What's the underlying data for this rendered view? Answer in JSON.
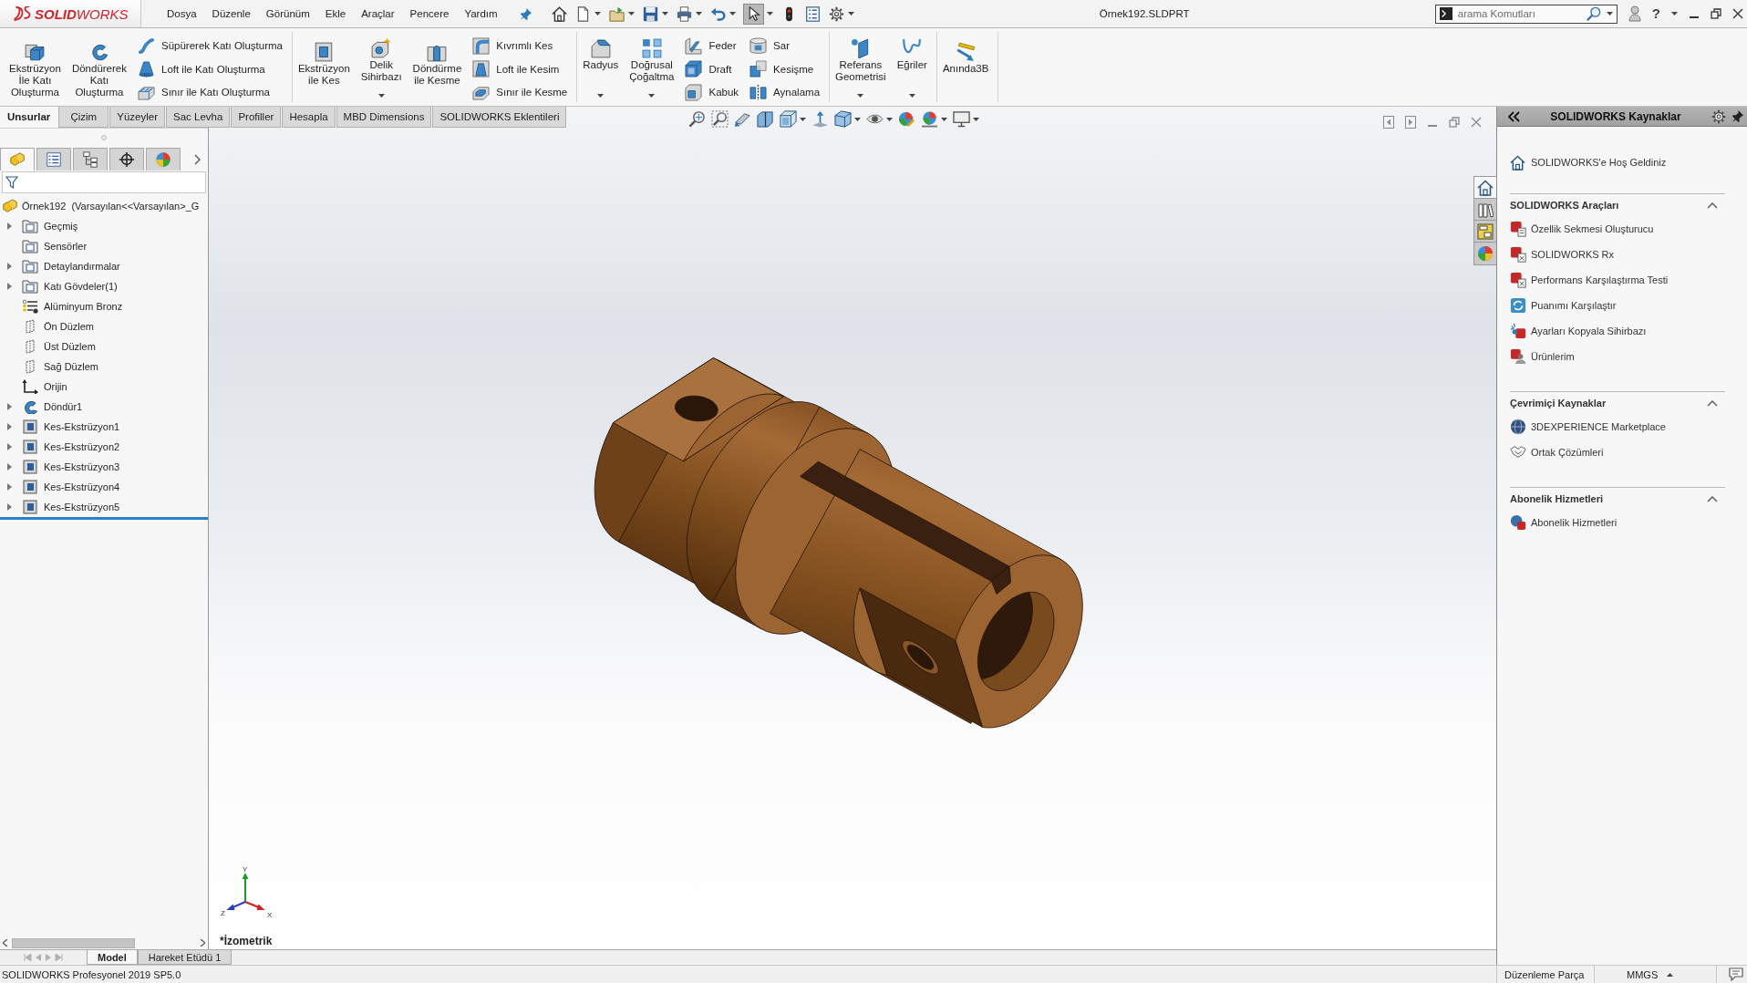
{
  "title_bar": {
    "logo": "**SOLID**WORKS",
    "menu": [
      "Dosya",
      "Düzenle",
      "Görünüm",
      "Ekle",
      "Araçlar",
      "Pencere",
      "Yardım"
    ],
    "quick_access": [
      {
        "dropdown": false,
        "selected": false
      },
      {
        "dropdown": true,
        "selected": false
      },
      {
        "dropdown": true,
        "selected": false
      },
      {
        "dropdown": true,
        "selected": false
      },
      {
        "dropdown": true,
        "selected": false
      },
      {
        "dropdown": true,
        "selected": false
      },
      {
        "dropdown": true,
        "selected": true
      },
      {
        "dropdown": false,
        "selected": false
      },
      {
        "dropdown": false,
        "selected": false
      },
      {
        "dropdown": true,
        "selected": false
      }
    ],
    "document": "Örnek192.SLDPRT",
    "search": {
      "placeholder": "arama Komutları"
    },
    "help": "?"
  },
  "ribbon": [
    {
      "columns": [
        {
          "kind": "large",
          "label": "Ekstrüzyon\nİle Katı\nOluşturma",
          "dropdown": false
        },
        {
          "kind": "large",
          "label": "Döndürerek\nKatı\nOluşturma",
          "dropdown": false
        },
        {
          "kind": "stack",
          "items": [
            "Süpürerek Katı Oluşturma",
            "Loft ile Katı Oluşturma",
            "Sınır ile Katı Oluşturma"
          ]
        }
      ]
    },
    {
      "columns": [
        {
          "kind": "large",
          "label": "Ekstrüzyon\nile Kes",
          "dropdown": false
        },
        {
          "kind": "large",
          "label": "Delik\nSihirbazı",
          "dropdown": true
        },
        {
          "kind": "large",
          "label": "Döndürme\nile Kesme",
          "dropdown": false
        },
        {
          "kind": "stack",
          "items": [
            "Kıvrımlı Kes",
            "Loft ile Kesim",
            "Sınır ile Kesme"
          ]
        }
      ]
    },
    {
      "columns": [
        {
          "kind": "large",
          "label": "Radyus",
          "dropdown": true
        },
        {
          "kind": "large",
          "label": "Doğrusal\nÇoğaltma",
          "dropdown": true
        },
        {
          "kind": "stack",
          "items": [
            "Feder",
            "Draft",
            "Kabuk"
          ]
        },
        {
          "kind": "stack",
          "items": [
            "Sar",
            "Kesişme",
            "Aynalama"
          ]
        }
      ]
    },
    {
      "columns": [
        {
          "kind": "large",
          "label": "Referans\nGeometrisi",
          "dropdown": true
        },
        {
          "kind": "large",
          "label": "Eğriler",
          "dropdown": true
        }
      ]
    },
    {
      "columns": [
        {
          "kind": "large",
          "label": "Anında3B",
          "dropdown": false
        }
      ]
    }
  ],
  "command_tabs": [
    {
      "label": "Unsurlar",
      "selected": true
    },
    {
      "label": "Çizim",
      "selected": false
    },
    {
      "label": "Yüzeyler",
      "selected": false
    },
    {
      "label": "Sac Levha",
      "selected": false
    },
    {
      "label": "Profiller",
      "selected": false
    },
    {
      "label": "Hesapla",
      "selected": false
    },
    {
      "label": "MBD Dimensions",
      "selected": false
    },
    {
      "label": "SOLIDWORKS Eklentileri",
      "selected": false
    }
  ],
  "feature_manager": {
    "panel_tabs": [
      {
        "selected": true
      },
      {
        "selected": false
      },
      {
        "selected": false
      },
      {
        "selected": false
      },
      {
        "selected": false
      }
    ],
    "tree": {
      "label": "Örnek192  (Varsayılan<<Varsayılan>_G",
      "children": [
        {
          "label": "Geçmiş",
          "kind": "folder",
          "expandable": true
        },
        {
          "label": "Sensörler",
          "kind": "folder",
          "expandable": false
        },
        {
          "label": "Detaylandırmalar",
          "kind": "folder",
          "expandable": true
        },
        {
          "label": "Katı Gövdeler(1)",
          "kind": "folder",
          "expandable": true
        },
        {
          "label": "Alüminyum Bronz",
          "kind": "material",
          "expandable": false
        },
        {
          "label": "Ön Düzlem",
          "kind": "plane",
          "expandable": false
        },
        {
          "label": "Üst Düzlem",
          "kind": "plane",
          "expandable": false
        },
        {
          "label": "Sağ Düzlem",
          "kind": "plane",
          "expandable": false
        },
        {
          "label": "Orijin",
          "kind": "origin",
          "expandable": false
        },
        {
          "label": "Döndür1",
          "kind": "revolve",
          "expandable": true
        },
        {
          "label": "Kes-Ekstrüzyon1",
          "kind": "cut",
          "expandable": true
        },
        {
          "label": "Kes-Ekstrüzyon2",
          "kind": "cut",
          "expandable": true
        },
        {
          "label": "Kes-Ekstrüzyon3",
          "kind": "cut",
          "expandable": true
        },
        {
          "label": "Kes-Ekstrüzyon4",
          "kind": "cut",
          "expandable": true
        },
        {
          "label": "Kes-Ekstrüzyon5",
          "kind": "cut",
          "expandable": true
        }
      ]
    }
  },
  "graphics": {
    "view_name": "*İzometrik",
    "triad": {
      "x": "X",
      "y": "Y",
      "z": "Z"
    }
  },
  "document_tabs": [
    {
      "label": "Model",
      "selected": true
    },
    {
      "label": "Hareket Etüdü 1",
      "selected": false
    }
  ],
  "task_pane": {
    "tabs": [
      {
        "selected": true
      },
      {
        "selected": false
      },
      {
        "selected": false
      },
      {
        "selected": false
      }
    ],
    "title": "SOLIDWORKS Kaynaklar",
    "welcome": "SOLIDWORKS'e Hoş Geldiniz",
    "sections": [
      {
        "title": "SOLIDWORKS Araçları",
        "expanded": true,
        "items": [
          "Özellik Sekmesi Oluşturucu",
          "SOLIDWORKS Rx",
          "Performans Karşılaştırma Testi",
          "Puanımı Karşılaştır",
          "Ayarları Kopyala Sihirbazı",
          "Ürünlerim"
        ]
      },
      {
        "title": "Çevrimiçi Kaynaklar",
        "expanded": true,
        "items": [
          "3DEXPERIENCE Marketplace",
          "Ortak Çözümleri"
        ]
      },
      {
        "title": "Abonelik Hizmetleri",
        "expanded": true,
        "items": [
          "Abonelik Hizmetleri"
        ]
      }
    ]
  },
  "status_bar": {
    "product": "SOLIDWORKS Profesyonel 2019 SP5.0",
    "mode": "Düzenleme Parça",
    "units": "MMGS"
  }
}
